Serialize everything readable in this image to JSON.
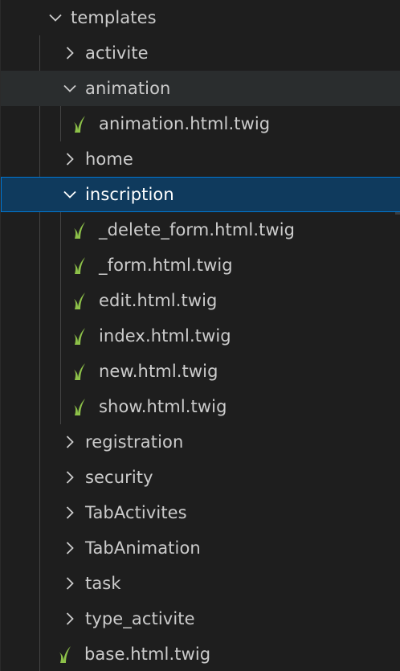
{
  "explorer": {
    "root": {
      "label": "templates",
      "state": "expanded"
    },
    "items": [
      {
        "label": "activite",
        "type": "folder",
        "state": "collapsed"
      },
      {
        "label": "animation",
        "type": "folder",
        "state": "expanded"
      },
      {
        "label": "animation.html.twig",
        "type": "file",
        "icon": "twig-file-icon"
      },
      {
        "label": "home",
        "type": "folder",
        "state": "collapsed"
      },
      {
        "label": "inscription",
        "type": "folder",
        "state": "expanded",
        "selected": true
      },
      {
        "label": "_delete_form.html.twig",
        "type": "file",
        "icon": "twig-file-icon"
      },
      {
        "label": "_form.html.twig",
        "type": "file",
        "icon": "twig-file-icon"
      },
      {
        "label": "edit.html.twig",
        "type": "file",
        "icon": "twig-file-icon"
      },
      {
        "label": "index.html.twig",
        "type": "file",
        "icon": "twig-file-icon"
      },
      {
        "label": "new.html.twig",
        "type": "file",
        "icon": "twig-file-icon"
      },
      {
        "label": "show.html.twig",
        "type": "file",
        "icon": "twig-file-icon"
      },
      {
        "label": "registration",
        "type": "folder",
        "state": "collapsed"
      },
      {
        "label": "security",
        "type": "folder",
        "state": "collapsed"
      },
      {
        "label": "TabActivites",
        "type": "folder",
        "state": "collapsed"
      },
      {
        "label": "TabAnimation",
        "type": "folder",
        "state": "collapsed"
      },
      {
        "label": "task",
        "type": "folder",
        "state": "collapsed"
      },
      {
        "label": "type_activite",
        "type": "folder",
        "state": "collapsed"
      },
      {
        "label": "base.html.twig",
        "type": "file",
        "icon": "twig-file-icon"
      }
    ]
  },
  "colors": {
    "background": "#1e1e1e",
    "selection": "#0f3a5d",
    "selection_border": "#0078d4",
    "hover": "#2a2d2e",
    "twig_icon": "#8dc149",
    "text": "#cccccc"
  }
}
